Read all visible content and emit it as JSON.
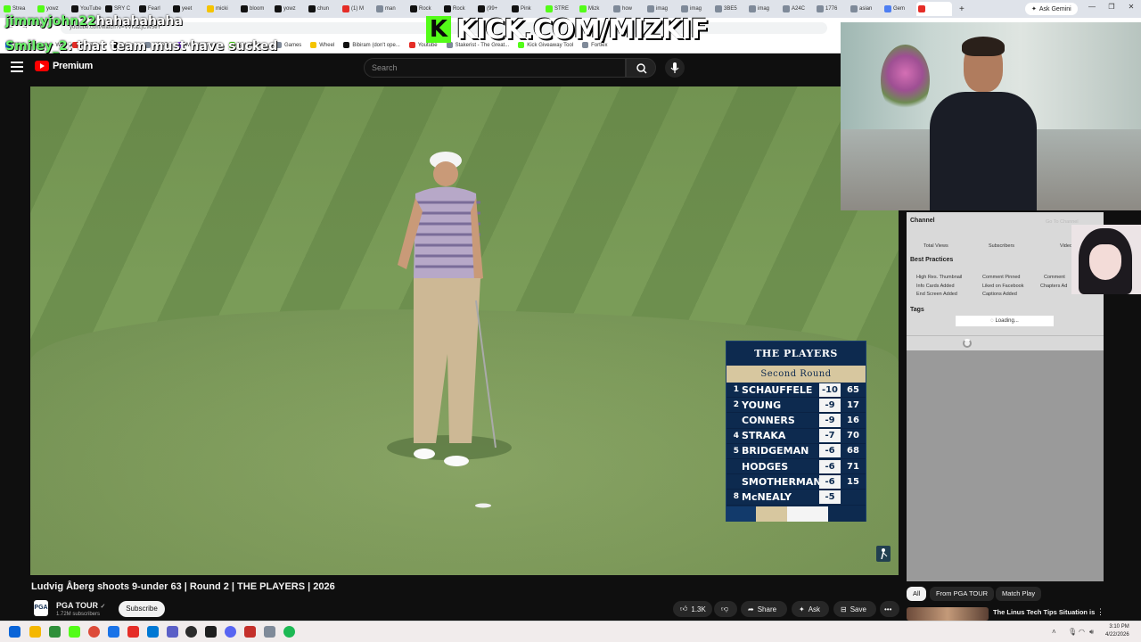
{
  "browser": {
    "tabs": [
      {
        "label": "Strea",
        "color": "#53fc18"
      },
      {
        "label": "yowz",
        "color": "#53fc18"
      },
      {
        "label": "YouTube",
        "color": "#111111"
      },
      {
        "label": "SRY C",
        "color": "#111111"
      },
      {
        "label": "Fearl",
        "color": "#111111"
      },
      {
        "label": "yeet",
        "color": "#111111"
      },
      {
        "label": "micki",
        "color": "#f5c400"
      },
      {
        "label": "bloom",
        "color": "#111111"
      },
      {
        "label": "yowz",
        "color": "#111111"
      },
      {
        "label": "chun",
        "color": "#111111"
      },
      {
        "label": "(1) M",
        "color": "#e52d27"
      },
      {
        "label": "man",
        "color": "#7f8a99"
      },
      {
        "label": "Rock",
        "color": "#111111"
      },
      {
        "label": "Rock",
        "color": "#111111"
      },
      {
        "label": "(99+",
        "color": "#111111"
      },
      {
        "label": "Pink",
        "color": "#111111"
      },
      {
        "label": "STRE",
        "color": "#53fc18"
      },
      {
        "label": "Mizk",
        "color": "#53fc18"
      },
      {
        "label": "how",
        "color": "#7f8a99"
      },
      {
        "label": "imag",
        "color": "#7f8a99"
      },
      {
        "label": "imag",
        "color": "#7f8a99"
      },
      {
        "label": "3BE5",
        "color": "#7f8a99"
      },
      {
        "label": "imag",
        "color": "#7f8a99"
      },
      {
        "label": "A24C",
        "color": "#7f8a99"
      },
      {
        "label": "1776",
        "color": "#7f8a99"
      },
      {
        "label": "asian",
        "color": "#7f8a99"
      },
      {
        "label": "Gem",
        "color": "#4d7ef2"
      },
      {
        "label": "",
        "color": "#e52d27",
        "active": true
      }
    ],
    "new_tab": "+",
    "ask_gemini": "Ask Gemini",
    "url": "youtube.com/watch?v=VVKaZjCW5eY",
    "bookmarks": [
      {
        "label": "Mail - Streamer - Wa",
        "color": "#1a73e8"
      },
      {
        "label": "YouTube",
        "color": "#e52d27"
      },
      {
        "label": "Twitter",
        "color": "#111111"
      },
      {
        "label": "XDDB",
        "color": "#7f8a99"
      },
      {
        "label": "Mizkif - Twitch",
        "color": "#9146ff"
      },
      {
        "label": "Kick Games",
        "color": "#53fc18"
      },
      {
        "label": "Games",
        "color": "#7f8a99"
      },
      {
        "label": "Wheel",
        "color": "#f5c400"
      },
      {
        "label": "Bibiram (don't ope...",
        "color": "#111111"
      },
      {
        "label": "Youtube",
        "color": "#e52d27"
      },
      {
        "label": "Stakerist - The Great...",
        "color": "#7f8a99"
      },
      {
        "label": "Kick Giveaway Tool",
        "color": "#53fc18"
      },
      {
        "label": "Fortlex",
        "color": "#7f8a99"
      }
    ]
  },
  "chat": [
    {
      "user": "jimmyjohn22",
      "message": "hahahahaha"
    },
    {
      "user": "Smiley_2",
      "message": ": that team must have sucked"
    }
  ],
  "kick_banner": {
    "logo": "K",
    "text": "KICK.COM/MIZKIF"
  },
  "youtube": {
    "logo_text": "Premium",
    "search_placeholder": "Search",
    "video_title": "Ludvig Åberg shoots 9-under 63 | Round 2 | THE PLAYERS | 2026",
    "channel": {
      "name": "PGA TOUR",
      "avatar": "PGA",
      "verified": "✓",
      "subscribers": "1.72M subscribers"
    },
    "subscribe_label": "Subscribe",
    "likes": "1.3K",
    "share_label": "Share",
    "ask_label": "Ask",
    "save_label": "Save",
    "more_label": "•••",
    "chips": [
      {
        "label": "All",
        "active": true
      },
      {
        "label": "From PGA TOUR",
        "active": false
      },
      {
        "label": "Match Play",
        "active": false
      }
    ],
    "related_title": "The Linus Tech Tips Situation is"
  },
  "scoreboard": {
    "logo": "THE PLAYERS",
    "round": "Second Round",
    "rows": [
      {
        "pos": "1",
        "name": "SCHAUFFELE",
        "score": "-10",
        "thru": "65"
      },
      {
        "pos": "2",
        "name": "YOUNG",
        "score": "-9",
        "thru": "17"
      },
      {
        "pos": "",
        "name": "CONNERS",
        "score": "-9",
        "thru": "16"
      },
      {
        "pos": "4",
        "name": "STRAKA",
        "score": "-7",
        "thru": "70"
      },
      {
        "pos": "5",
        "name": "BRIDGEMAN",
        "score": "-6",
        "thru": "68"
      },
      {
        "pos": "",
        "name": "HODGES",
        "score": "-6",
        "thru": "71"
      },
      {
        "pos": "",
        "name": "SMOTHERMAN",
        "score": "-6",
        "thru": "15"
      },
      {
        "pos": "8",
        "name": "McNEALY",
        "score": "-5",
        "thru": ""
      }
    ],
    "colors": {
      "navy": "#0d2a4f",
      "gold": "#d7c79f"
    }
  },
  "extension": {
    "channel": "Channel",
    "go_to_channel": "Go To Channel",
    "stats": [
      "Total Views",
      "Subscribers",
      "Video"
    ],
    "best_practices": "Best Practices",
    "checks": [
      "High Res. Thumbnail",
      "Comment Pinned",
      "Comment",
      "Info Cards Added",
      "Liked on Facebook",
      "Chapters Ad",
      "End Screen Added",
      "Captions Added"
    ],
    "tags": "Tags",
    "loading": "Loading..."
  },
  "taskbar": {
    "time": "3:10 PM",
    "date": "4/22/2026",
    "icons": [
      {
        "name": "start-icon",
        "color": "#0a64d8"
      },
      {
        "name": "file-explorer-icon",
        "color": "#f5b700"
      },
      {
        "name": "app-icon",
        "color": "#2f8f3a"
      },
      {
        "name": "kick-icon",
        "color": "#53fc18"
      },
      {
        "name": "chrome-icon",
        "color": "#dd4b39"
      },
      {
        "name": "app-icon",
        "color": "#1a73e8"
      },
      {
        "name": "app-icon",
        "color": "#e52d27"
      },
      {
        "name": "app-icon",
        "color": "#0078d4"
      },
      {
        "name": "app-icon",
        "color": "#5b5fc7"
      },
      {
        "name": "obs-icon",
        "color": "#2b2b2b"
      },
      {
        "name": "app-icon",
        "color": "#1e1e1e"
      },
      {
        "name": "discord-icon",
        "color": "#5865f2"
      },
      {
        "name": "app-icon",
        "color": "#c4302b"
      },
      {
        "name": "app-icon",
        "color": "#7f8a99"
      },
      {
        "name": "spotify-icon",
        "color": "#1db954"
      }
    ]
  }
}
